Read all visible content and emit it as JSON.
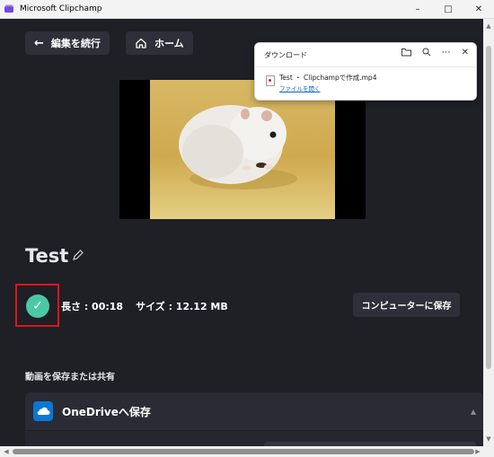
{
  "window": {
    "title": "Microsoft Clipchamp"
  },
  "nav": {
    "back_label": "編集を続行",
    "home_label": "ホーム"
  },
  "project": {
    "title": "Test"
  },
  "export_info": {
    "length_label": "長さ : 00:18",
    "size_label": "サイズ : 12.12 MB"
  },
  "save_button": {
    "label": "コンピューターに保存"
  },
  "share": {
    "heading": "動画を保存または共有",
    "onedrive_label": "OneDriveへ保存"
  },
  "download_popup": {
    "title": "ダウンロード",
    "filename": "Test ・ Clipchampで作成.mp4",
    "open_link": "ファイルを開く"
  },
  "colors": {
    "accent_green": "#4dc8a6",
    "highlight_red": "#e1141b",
    "background": "#1f1f26",
    "onedrive_blue": "#0a78d4"
  }
}
